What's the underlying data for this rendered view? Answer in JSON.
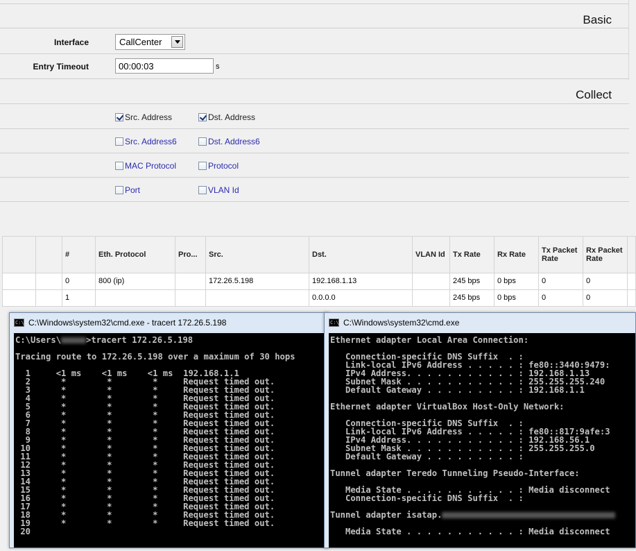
{
  "form": {
    "basic_title": "Basic",
    "interface_label": "Interface",
    "interface_value": "CallCenter",
    "timeout_label": "Entry Timeout",
    "timeout_value": "00:00:03",
    "timeout_unit": "s",
    "collect_title": "Collect",
    "checkboxes": [
      {
        "label": "Src. Address",
        "checked": true
      },
      {
        "label": "Dst. Address",
        "checked": true
      },
      {
        "label": "Src. Address6",
        "checked": false
      },
      {
        "label": "Dst. Address6",
        "checked": false
      },
      {
        "label": "MAC Protocol",
        "checked": false
      },
      {
        "label": "Protocol",
        "checked": false
      },
      {
        "label": "Port",
        "checked": false
      },
      {
        "label": "VLAN Id",
        "checked": false
      }
    ]
  },
  "table": {
    "headers": [
      "",
      "",
      "#",
      "Eth. Protocol",
      "Pro...",
      "Src.",
      "Dst.",
      "VLAN Id",
      "Tx Rate",
      "Rx Rate",
      "Tx Packet Rate",
      "Rx Packet Rate"
    ],
    "rows": [
      [
        "",
        "",
        "0",
        "800 (ip)",
        "",
        "172.26.5.198",
        "192.168.1.13",
        "",
        "245 bps",
        "0 bps",
        "0",
        "0"
      ],
      [
        "",
        "",
        "1",
        "",
        "",
        "",
        "0.0.0.0",
        "",
        "245 bps",
        "0 bps",
        "0",
        "0"
      ]
    ]
  },
  "cmd_tracert": {
    "title": "C:\\Windows\\system32\\cmd.exe - tracert  172.26.5.198",
    "prompt_prefix": "C:\\Users\\",
    "prompt_suffix": ">tracert 172.26.5.198",
    "header": "Tracing route to 172.26.5.198 over a maximum of 30 hops",
    "hops": [
      "  1     <1 ms    <1 ms    <1 ms  192.168.1.1",
      "  2      *        *        *     Request timed out.",
      "  3      *        *        *     Request timed out.",
      "  4      *        *        *     Request timed out.",
      "  5      *        *        *     Request timed out.",
      "  6      *        *        *     Request timed out.",
      "  7      *        *        *     Request timed out.",
      "  8      *        *        *     Request timed out.",
      "  9      *        *        *     Request timed out.",
      " 10      *        *        *     Request timed out.",
      " 11      *        *        *     Request timed out.",
      " 12      *        *        *     Request timed out.",
      " 13      *        *        *     Request timed out.",
      " 14      *        *        *     Request timed out.",
      " 15      *        *        *     Request timed out.",
      " 16      *        *        *     Request timed out.",
      " 17      *        *        *     Request timed out.",
      " 18      *        *        *     Request timed out.",
      " 19      *        *        *     Request timed out.",
      " 20"
    ]
  },
  "cmd_ipconfig": {
    "title": "C:\\Windows\\system32\\cmd.exe",
    "lines_a": [
      "Ethernet adapter Local Area Connection:",
      "",
      "   Connection-specific DNS Suffix  . :",
      "   Link-local IPv6 Address . . . . . : fe80::3440:9479:",
      "   IPv4 Address. . . . . . . . . . . : 192.168.1.13",
      "   Subnet Mask . . . . . . . . . . . : 255.255.255.240",
      "   Default Gateway . . . . . . . . . : 192.168.1.1",
      "",
      "Ethernet adapter VirtualBox Host-Only Network:",
      "",
      "   Connection-specific DNS Suffix  . :",
      "   Link-local IPv6 Address . . . . . : fe80::817:9afe:3",
      "   IPv4 Address. . . . . . . . . . . : 192.168.56.1",
      "   Subnet Mask . . . . . . . . . . . : 255.255.255.0",
      "   Default Gateway . . . . . . . . . :",
      "",
      "Tunnel adapter Teredo Tunneling Pseudo-Interface:",
      "",
      "   Media State . . . . . . . . . . . : Media disconnect",
      "   Connection-specific DNS Suffix  . :",
      ""
    ],
    "isatap_prefix": "Tunnel adapter isatap.",
    "lines_b": [
      "",
      "   Media State . . . . . . . . . . . : Media disconnect"
    ]
  }
}
